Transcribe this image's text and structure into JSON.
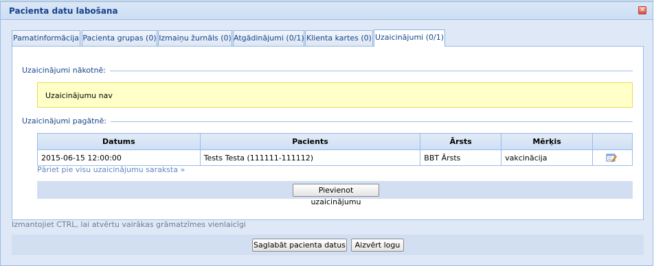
{
  "window": {
    "title": "Pacienta datu labošana"
  },
  "tabs": [
    {
      "label": "Pamatinformācija"
    },
    {
      "label": "Pacienta grupas (0)"
    },
    {
      "label": "Izmaiņu žurnāls (0)"
    },
    {
      "label": "Atgādinājumi (0/1)"
    },
    {
      "label": "Klienta kartes (0)"
    },
    {
      "label": "Uzaicinājumi (0/1)"
    }
  ],
  "active_tab": "Uzaicinājumi (0/1)",
  "future": {
    "legend": "Uzaicinājumi nākotnē:",
    "empty_text": "Uzaicinājumu nav"
  },
  "past": {
    "legend": "Uzaicinājumi pagātnē:",
    "columns": [
      "Datums",
      "Pacients",
      "Ārsts",
      "Mērķis",
      ""
    ],
    "rows": [
      {
        "date": "2015-06-15 12:00:00",
        "patient": "Tests Testa (111111-111112)",
        "doctor": "BBT Ārsts",
        "goal": "vakcinācija"
      }
    ],
    "link_text": "Pāriet pie visu uzaicinājumu saraksta »",
    "add_button": "Pievienot uzaicinājumu"
  },
  "hint": "Izmantojiet CTRL, lai atvērtu vairākas grāmatzīmes vienlaicīgi",
  "footer": {
    "save_button": "Saglabāt pacienta datus",
    "close_button": "Aizvērt logu"
  }
}
